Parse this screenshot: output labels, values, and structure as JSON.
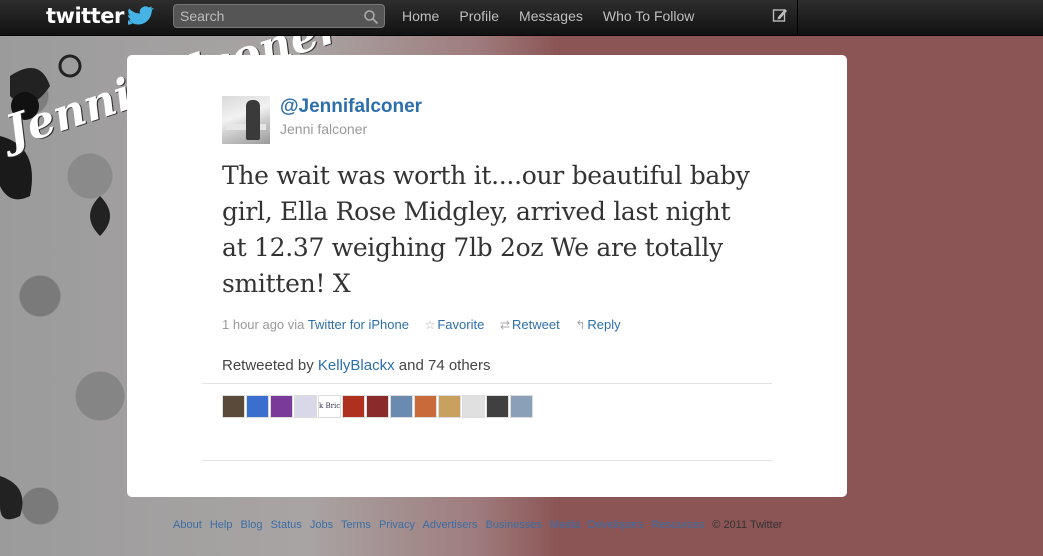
{
  "topbar": {
    "logo": "twitter",
    "search": {
      "placeholder": "Search"
    },
    "nav": [
      "Home",
      "Profile",
      "Messages",
      "Who To Follow"
    ]
  },
  "background": {
    "script_text": "Jenni falconer"
  },
  "tweet": {
    "screen_name": "@Jennifalconer",
    "full_name": "Jenni falconer",
    "text": "The wait was worth it....our beautiful baby girl, Ella Rose Midgley, arrived last night at 12.37 weighing 7lb 2oz  We are totally smitten! X",
    "time": "1 hour ago",
    "via_label": "via",
    "source": "Twitter for iPhone",
    "actions": {
      "favorite": "Favorite",
      "retweet": "Retweet",
      "reply": "Reply"
    },
    "retweeted_prefix": "Retweeted by",
    "retweeted_by": "KellyBlackx",
    "retweeted_suffix": "and 74 others",
    "retweeter_avatar_colors": [
      "#5a4a3a",
      "#3a6fd0",
      "#7a3a9a",
      "#d8d8e8",
      "#ffffff",
      "#b03020",
      "#8a2a2a",
      "#6a8ab0",
      "#c86a3a",
      "#c8a060",
      "#e0e0e0",
      "#404040",
      "#8aa0b8"
    ],
    "avatar_text_label": "k Bric"
  },
  "footer": {
    "links": [
      "About",
      "Help",
      "Blog",
      "Status",
      "Jobs",
      "Terms",
      "Privacy",
      "Advertisers",
      "Businesses",
      "Media",
      "Developers",
      "Resources"
    ],
    "copyright": "© 2011 Twitter"
  },
  "colors": {
    "link": "#2d6fab",
    "page_bg": "#8b5455",
    "topbar": "#1a1a1a"
  }
}
